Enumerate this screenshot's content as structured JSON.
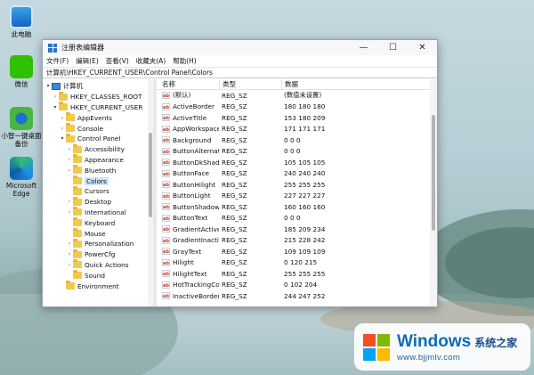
{
  "desktop": {
    "icons": [
      {
        "label": "此电脑",
        "icon": "computer-icon"
      },
      {
        "label": "微信",
        "icon": "wechat-icon"
      },
      {
        "label": "小智一键桌面备份",
        "icon": "sync-icon"
      },
      {
        "label": "Microsoft Edge",
        "icon": "edge-icon"
      }
    ]
  },
  "window": {
    "title": "注册表编辑器",
    "controls": {
      "minimize": "—",
      "maximize": "☐",
      "close": "✕"
    },
    "menu": [
      "文件(F)",
      "编辑(E)",
      "查看(V)",
      "收藏夹(A)",
      "帮助(H)"
    ],
    "address": "计算机\\HKEY_CURRENT_USER\\Control Panel\\Colors"
  },
  "tree": [
    {
      "label": "计算机",
      "expand": "▾",
      "kind": "computer"
    },
    {
      "label": "HKEY_CLASSES_ROOT",
      "expand": "›",
      "kind": "folder"
    },
    {
      "label": "HKEY_CURRENT_USER",
      "expand": "▾",
      "kind": "folder"
    },
    {
      "label": "AppEvents",
      "expand": "›",
      "kind": "folder"
    },
    {
      "label": "Console",
      "expand": "›",
      "kind": "folder"
    },
    {
      "label": "Control Panel",
      "expand": "▾",
      "kind": "folder"
    },
    {
      "label": "Accessibility",
      "expand": "›",
      "kind": "folder"
    },
    {
      "label": "Appearance",
      "expand": "›",
      "kind": "folder"
    },
    {
      "label": "Bluetooth",
      "expand": "›",
      "kind": "folder"
    },
    {
      "label": "Colors",
      "expand": "",
      "kind": "folder",
      "selected": true
    },
    {
      "label": "Cursors",
      "expand": "",
      "kind": "folder"
    },
    {
      "label": "Desktop",
      "expand": "›",
      "kind": "folder"
    },
    {
      "label": "International",
      "expand": "›",
      "kind": "folder"
    },
    {
      "label": "Keyboard",
      "expand": "",
      "kind": "folder"
    },
    {
      "label": "Mouse",
      "expand": "",
      "kind": "folder"
    },
    {
      "label": "Personalization",
      "expand": "›",
      "kind": "folder"
    },
    {
      "label": "PowerCfg",
      "expand": "›",
      "kind": "folder"
    },
    {
      "label": "Quick Actions",
      "expand": "›",
      "kind": "folder"
    },
    {
      "label": "Sound",
      "expand": "",
      "kind": "folder"
    },
    {
      "label": "Environment",
      "expand": "",
      "kind": "folder"
    }
  ],
  "list": {
    "columns": {
      "name": "名称",
      "type": "类型",
      "data": "数据"
    },
    "value_icon": "ab",
    "rows": [
      {
        "name": "(默认)",
        "type": "REG_SZ",
        "data": "(数值未设置)"
      },
      {
        "name": "ActiveBorder",
        "type": "REG_SZ",
        "data": "180 180 180"
      },
      {
        "name": "ActiveTitle",
        "type": "REG_SZ",
        "data": "153 180 209"
      },
      {
        "name": "AppWorkspace",
        "type": "REG_SZ",
        "data": "171 171 171"
      },
      {
        "name": "Background",
        "type": "REG_SZ",
        "data": "0 0 0"
      },
      {
        "name": "ButtonAlternat...",
        "type": "REG_SZ",
        "data": "0 0 0"
      },
      {
        "name": "ButtonDkShad...",
        "type": "REG_SZ",
        "data": "105 105 105"
      },
      {
        "name": "ButtonFace",
        "type": "REG_SZ",
        "data": "240 240 240"
      },
      {
        "name": "ButtonHilight",
        "type": "REG_SZ",
        "data": "255 255 255"
      },
      {
        "name": "ButtonLight",
        "type": "REG_SZ",
        "data": "227 227 227"
      },
      {
        "name": "ButtonShadow",
        "type": "REG_SZ",
        "data": "160 160 160"
      },
      {
        "name": "ButtonText",
        "type": "REG_SZ",
        "data": "0 0 0"
      },
      {
        "name": "GradientActive...",
        "type": "REG_SZ",
        "data": "185 209 234"
      },
      {
        "name": "GradientInactiv...",
        "type": "REG_SZ",
        "data": "215 228 242"
      },
      {
        "name": "GrayText",
        "type": "REG_SZ",
        "data": "109 109 109"
      },
      {
        "name": "Hilight",
        "type": "REG_SZ",
        "data": "0 120 215"
      },
      {
        "name": "HilightText",
        "type": "REG_SZ",
        "data": "255 255 255"
      },
      {
        "name": "HotTrackingCo...",
        "type": "REG_SZ",
        "data": "0 102 204"
      },
      {
        "name": "InactiveBorder",
        "type": "REG_SZ",
        "data": "244 247 252"
      }
    ]
  },
  "watermark": {
    "brand": "Windows",
    "brand_cn": "系统之家",
    "url": "www.bjjmlv.com"
  }
}
